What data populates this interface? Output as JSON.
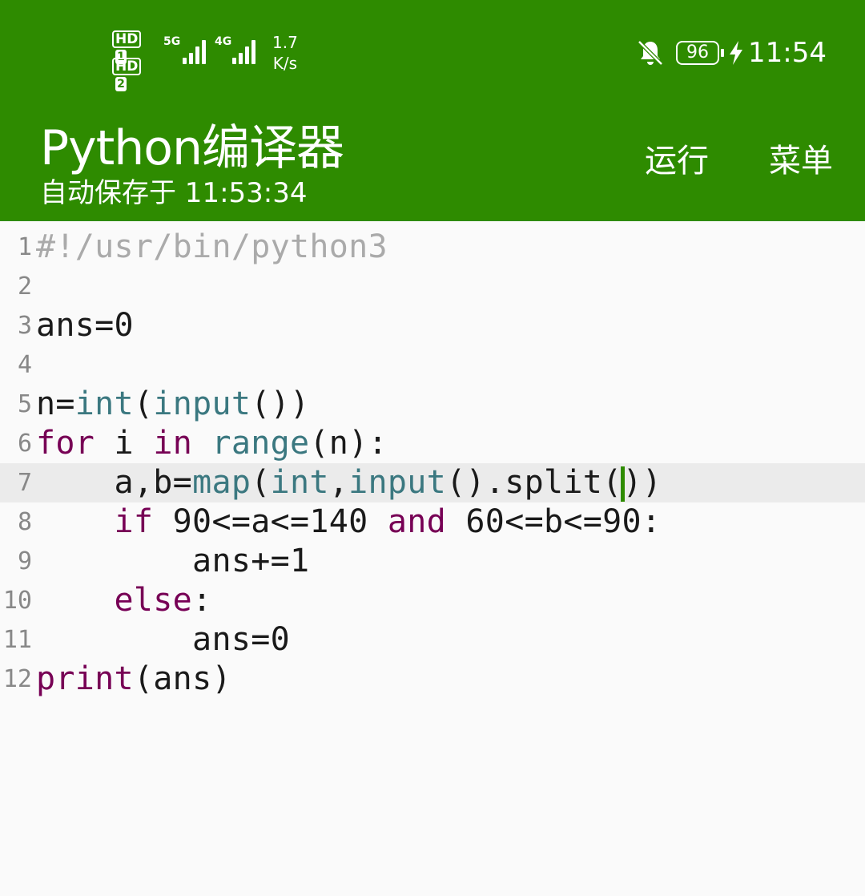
{
  "status_bar": {
    "sim1_label": "HD",
    "sim1_num": "1",
    "sim2_label": "HD",
    "sim2_num": "2",
    "net1_type": "5G",
    "net2_type": "4G",
    "speed_value": "1.7",
    "speed_unit": "K/s",
    "battery": "96",
    "time": "11:54",
    "icons": [
      "bell-off-icon",
      "battery-icon",
      "charging-bolt-icon",
      "signal-icon"
    ]
  },
  "appbar": {
    "title": "Python编译器",
    "subtitle": "自动保存于 11:53:34",
    "run_label": "运行",
    "menu_label": "菜单",
    "color": "#2e8b00"
  },
  "editor": {
    "active_line": 7,
    "lines": [
      {
        "num": "1",
        "tokens": [
          {
            "t": "#!/usr/bin/python3",
            "c": "cm"
          }
        ]
      },
      {
        "num": "2",
        "tokens": []
      },
      {
        "num": "3",
        "tokens": [
          {
            "t": "ans=0",
            "c": ""
          }
        ]
      },
      {
        "num": "4",
        "tokens": []
      },
      {
        "num": "5",
        "tokens": [
          {
            "t": "n=",
            "c": ""
          },
          {
            "t": "int",
            "c": "bi"
          },
          {
            "t": "(",
            "c": ""
          },
          {
            "t": "input",
            "c": "bi"
          },
          {
            "t": "())",
            "c": ""
          }
        ]
      },
      {
        "num": "6",
        "tokens": [
          {
            "t": "for",
            "c": "kw"
          },
          {
            "t": " i ",
            "c": ""
          },
          {
            "t": "in",
            "c": "kw"
          },
          {
            "t": " ",
            "c": ""
          },
          {
            "t": "range",
            "c": "bi"
          },
          {
            "t": "(n):",
            "c": ""
          }
        ]
      },
      {
        "num": "7",
        "tokens": [
          {
            "t": "    a,b=",
            "c": ""
          },
          {
            "t": "map",
            "c": "bi"
          },
          {
            "t": "(",
            "c": ""
          },
          {
            "t": "int",
            "c": "bi"
          },
          {
            "t": ",",
            "c": ""
          },
          {
            "t": "input",
            "c": "bi"
          },
          {
            "t": "().split(",
            "c": ""
          },
          {
            "t": "|",
            "c": "cursor"
          },
          {
            "t": "))",
            "c": ""
          }
        ]
      },
      {
        "num": "8",
        "tokens": [
          {
            "t": "    ",
            "c": ""
          },
          {
            "t": "if",
            "c": "kw"
          },
          {
            "t": " 90<=a<=140 ",
            "c": ""
          },
          {
            "t": "and",
            "c": "kw"
          },
          {
            "t": " 60<=b<=90:",
            "c": ""
          }
        ]
      },
      {
        "num": "9",
        "tokens": [
          {
            "t": "        ans+=1",
            "c": ""
          }
        ]
      },
      {
        "num": "10",
        "tokens": [
          {
            "t": "    ",
            "c": ""
          },
          {
            "t": "else",
            "c": "kw"
          },
          {
            "t": ":",
            "c": ""
          }
        ]
      },
      {
        "num": "11",
        "tokens": [
          {
            "t": "        ans=0",
            "c": ""
          }
        ]
      },
      {
        "num": "12",
        "tokens": [
          {
            "t": "print",
            "c": "kw"
          },
          {
            "t": "(ans)",
            "c": ""
          }
        ]
      }
    ]
  }
}
